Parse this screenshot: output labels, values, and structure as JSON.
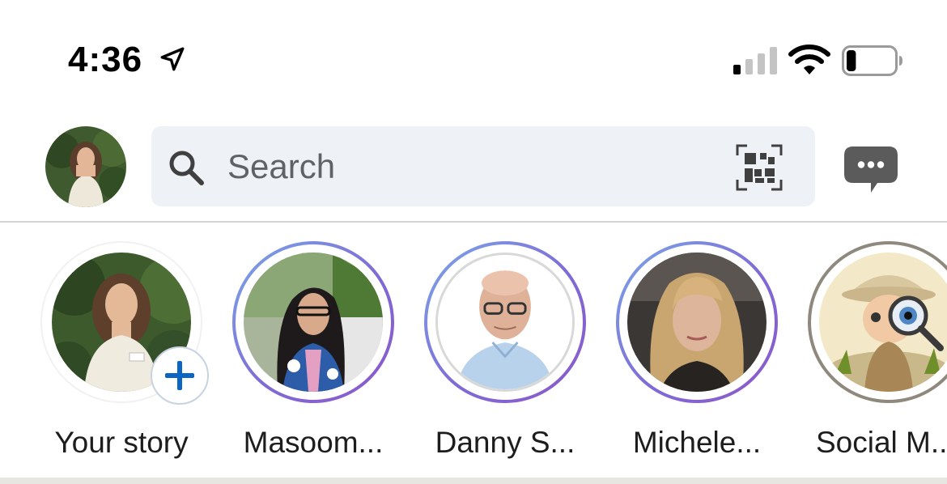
{
  "status_bar": {
    "time": "4:36",
    "location_icon": "location-arrow-icon",
    "signal_icon": "cellular-signal-icon",
    "wifi_icon": "wifi-icon",
    "battery_icon": "battery-icon",
    "battery_level": 0.2
  },
  "nav": {
    "search": {
      "placeholder": "Search",
      "value": ""
    },
    "qr_icon": "qr-code-icon",
    "messaging_icon": "messaging-icon"
  },
  "stories": [
    {
      "label": "Your story",
      "add_icon": "plus-icon"
    },
    {
      "label": "Masoom..."
    },
    {
      "label": "Danny S..."
    },
    {
      "label": "Michele..."
    },
    {
      "label": "Social M..."
    }
  ],
  "colors": {
    "accent_blue": "#0a66c2",
    "ring_start": "#7ba7e8",
    "ring_end": "#8d58c9",
    "search_bg": "#eef2f6"
  }
}
